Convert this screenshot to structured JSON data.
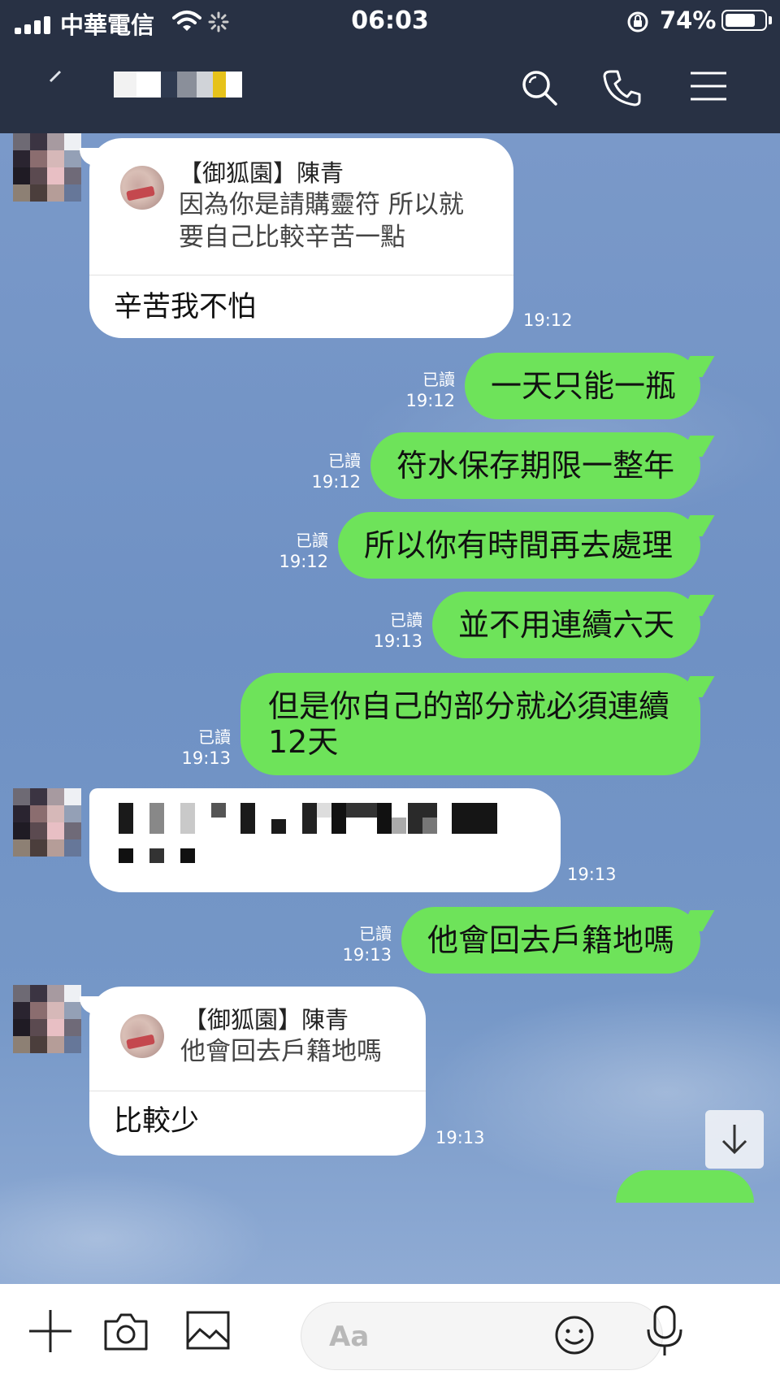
{
  "status_bar": {
    "carrier": "中華電信",
    "time": "06:03",
    "battery": "74%"
  },
  "header": {
    "icons": [
      "back-icon",
      "search-icon",
      "phone-icon",
      "menu-icon"
    ]
  },
  "messages": [
    {
      "side": "in",
      "quote_name": "【御狐園】陳青",
      "quote_lines": [
        "因為你是請購靈符 所以就",
        "要自己比較辛苦一點"
      ],
      "text": "辛苦我不怕",
      "time": "19:12"
    },
    {
      "side": "out",
      "read": "已讀",
      "time": "19:12",
      "text": "一天只能一瓶"
    },
    {
      "side": "out",
      "read": "已讀",
      "time": "19:12",
      "text": "符水保存期限一整年"
    },
    {
      "side": "out",
      "read": "已讀",
      "time": "19:12",
      "text": "所以你有時間再去處理"
    },
    {
      "side": "out",
      "read": "已讀",
      "time": "19:13",
      "text": "並不用連續六天"
    },
    {
      "side": "out",
      "read": "已讀",
      "time": "19:13",
      "lines": [
        "但是你自己的部分就必須連續",
        "12天"
      ]
    },
    {
      "side": "in",
      "obscured": true,
      "time": "19:13"
    },
    {
      "side": "out",
      "read": "已讀",
      "time": "19:13",
      "text": "他會回去戶籍地嗎"
    },
    {
      "side": "in",
      "quote_name": "【御狐園】陳青",
      "quote_lines": [
        "他會回去戶籍地嗎"
      ],
      "text": "比較少",
      "time": "19:13"
    }
  ],
  "input": {
    "placeholder": "Aa"
  },
  "colors": {
    "header_bg": "#283144",
    "outgoing_bubble": "#6ee35a",
    "incoming_bubble": "#ffffff",
    "chat_bg": "#7597c7"
  }
}
